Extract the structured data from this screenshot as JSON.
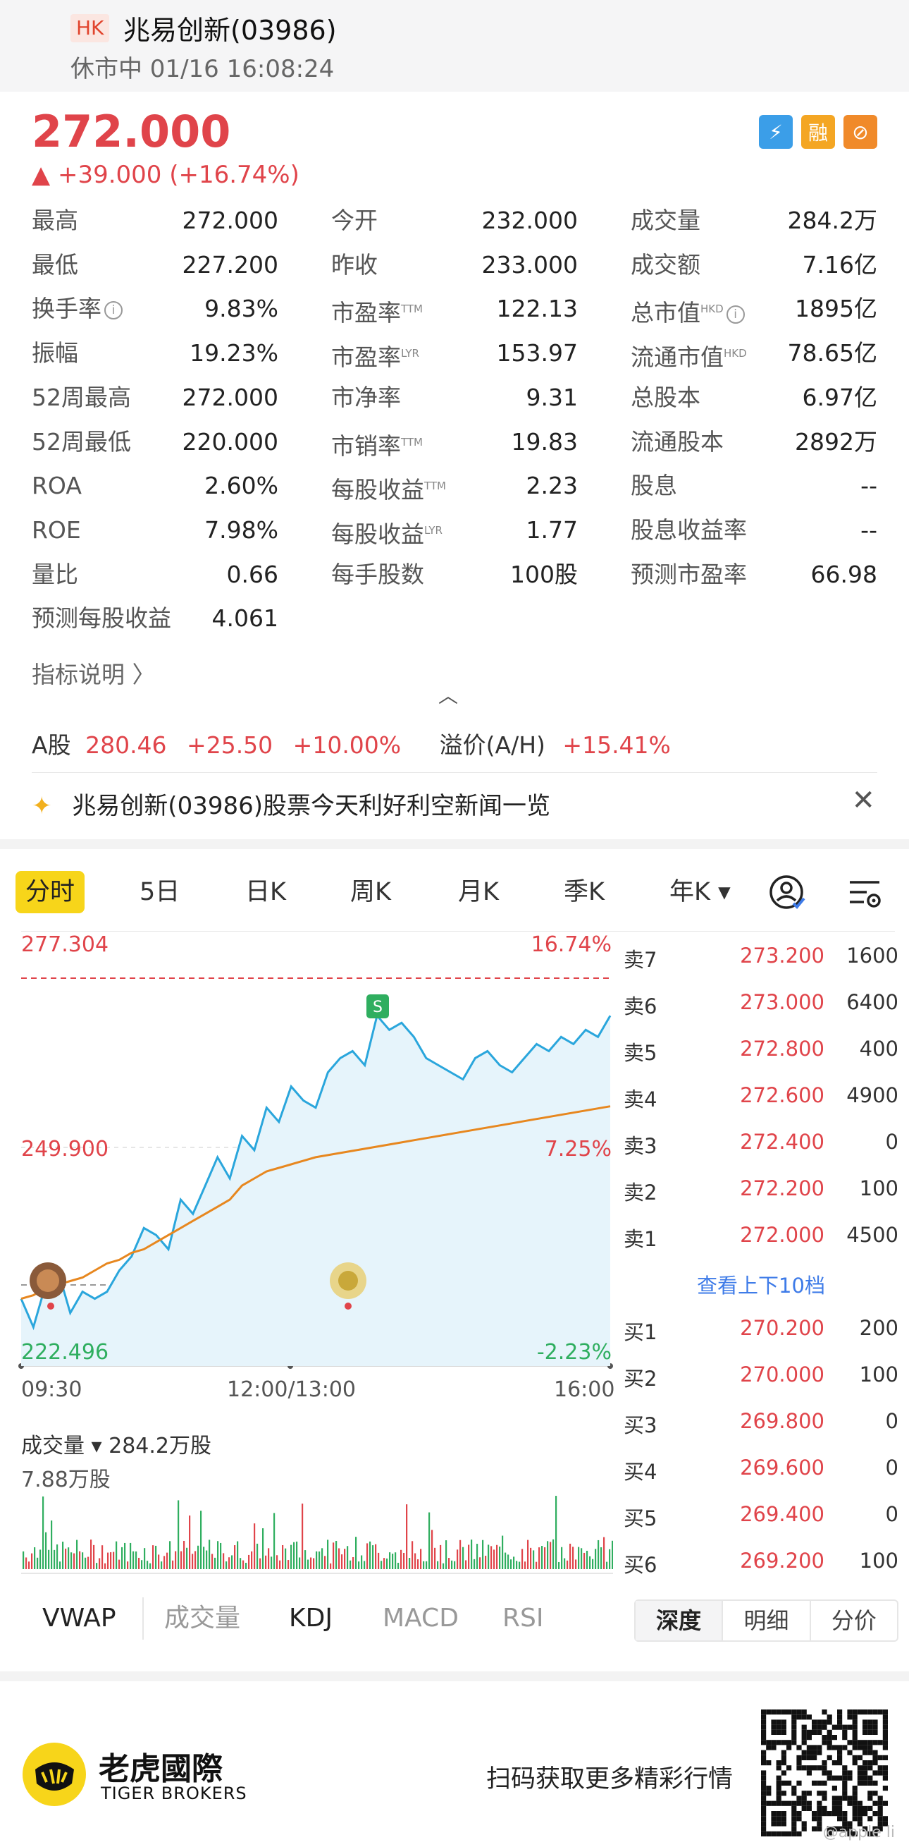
{
  "header": {
    "market_badge": "HK",
    "title": "兆易创新(03986)",
    "status": "休市中 01/16 16:08:24"
  },
  "quote": {
    "price": "272.000",
    "change": "▲ +39.000 (+16.74%)",
    "tag_icons": [
      "flash-icon",
      "margin-icon",
      "no-short-icon"
    ],
    "tag_icon_texts": [
      "⚡",
      "融",
      "⊘"
    ]
  },
  "stats": [
    [
      {
        "label": "最高",
        "sup": "",
        "value": "272.000"
      },
      {
        "label": "今开",
        "sup": "",
        "value": "232.000"
      },
      {
        "label": "成交量",
        "sup": "",
        "value": "284.2万"
      }
    ],
    [
      {
        "label": "最低",
        "sup": "",
        "value": "227.200"
      },
      {
        "label": "昨收",
        "sup": "",
        "value": "233.000"
      },
      {
        "label": "成交额",
        "sup": "",
        "value": "7.16亿"
      }
    ],
    [
      {
        "label": "换手率",
        "sup": "",
        "info": true,
        "value": "9.83%"
      },
      {
        "label": "市盈率",
        "sup": "TTM",
        "value": "122.13"
      },
      {
        "label": "总市值",
        "sup": "HKD",
        "info": true,
        "value": "1895亿"
      }
    ],
    [
      {
        "label": "振幅",
        "sup": "",
        "value": "19.23%"
      },
      {
        "label": "市盈率",
        "sup": "LYR",
        "value": "153.97"
      },
      {
        "label": "流通市值",
        "sup": "HKD",
        "value": "78.65亿"
      }
    ],
    [
      {
        "label": "52周最高",
        "sup": "",
        "value": "272.000"
      },
      {
        "label": "市净率",
        "sup": "",
        "value": "9.31"
      },
      {
        "label": "总股本",
        "sup": "",
        "value": "6.97亿"
      }
    ],
    [
      {
        "label": "52周最低",
        "sup": "",
        "value": "220.000"
      },
      {
        "label": "市销率",
        "sup": "TTM",
        "value": "19.83"
      },
      {
        "label": "流通股本",
        "sup": "",
        "value": "2892万"
      }
    ],
    [
      {
        "label": "ROA",
        "sup": "",
        "value": "2.60%"
      },
      {
        "label": "每股收益",
        "sup": "TTM",
        "value": "2.23"
      },
      {
        "label": "股息",
        "sup": "",
        "value": "--"
      }
    ],
    [
      {
        "label": "ROE",
        "sup": "",
        "value": "7.98%"
      },
      {
        "label": "每股收益",
        "sup": "LYR",
        "value": "1.77"
      },
      {
        "label": "股息收益率",
        "sup": "",
        "value": "--"
      }
    ],
    [
      {
        "label": "量比",
        "sup": "",
        "value": "0.66"
      },
      {
        "label": "每手股数",
        "sup": "",
        "value": "100股"
      },
      {
        "label": "预测市盈率",
        "sup": "",
        "value": "66.98"
      }
    ],
    [
      {
        "label": "预测每股收益",
        "sup": "",
        "value": "4.061"
      }
    ]
  ],
  "indicator_link": "指标说明 〉",
  "collapse_glyph": "︿",
  "a_share": {
    "label": "A股",
    "price": "280.46",
    "change": "+25.50",
    "pct": "+10.00%",
    "premium_label": "溢价(A/H)",
    "premium": "+15.41%"
  },
  "news": {
    "icon": "✦",
    "text": "兆易创新(03986)股票今天利好利空新闻一览",
    "close": "✕"
  },
  "chart_tabs": [
    "分时",
    "5日",
    "日K",
    "周K",
    "月K",
    "季K",
    "年K ▾"
  ],
  "chart_data": {
    "type": "line",
    "ylim": [
      222.496,
      277.304
    ],
    "y_labels_left": [
      "277.304",
      "249.900",
      "222.496"
    ],
    "y_labels_right": [
      "16.74%",
      "7.25%",
      "-2.23%"
    ],
    "x_ticks": [
      "09:30",
      "12:00/13:00",
      "16:00"
    ],
    "prev_close": 233.0,
    "series": [
      {
        "values": [
          232,
          228,
          234,
          236,
          230,
          233,
          232,
          233,
          236,
          238,
          242,
          241,
          239,
          246,
          244,
          248,
          252,
          249,
          255,
          253,
          259,
          257,
          262,
          260,
          259,
          264,
          266,
          267,
          265,
          272,
          270,
          271,
          269,
          266,
          265,
          264,
          263,
          266,
          267,
          265,
          264,
          266,
          268,
          267,
          269,
          268,
          270,
          269,
          272
        ]
      },
      {
        "values": [
          232,
          232.5,
          233.5,
          234,
          234.5,
          235,
          236,
          237,
          237.5,
          238.5,
          239,
          240,
          241,
          242,
          243,
          244,
          245,
          246,
          248,
          249,
          250,
          250.5,
          251,
          251.5,
          252,
          252.3,
          252.6,
          252.9,
          253.2,
          253.5,
          253.8,
          254.1,
          254.4,
          254.7,
          255,
          255.3,
          255.6,
          255.9,
          256.2,
          256.5,
          256.8,
          257.1,
          257.4,
          257.7,
          258,
          258.3,
          258.6,
          258.9,
          259.2
        ]
      }
    ]
  },
  "orderbook": {
    "asks": [
      {
        "side": "卖7",
        "price": "273.200",
        "qty": "1600"
      },
      {
        "side": "卖6",
        "price": "273.000",
        "qty": "6400"
      },
      {
        "side": "卖5",
        "price": "272.800",
        "qty": "400"
      },
      {
        "side": "卖4",
        "price": "272.600",
        "qty": "4900"
      },
      {
        "side": "卖3",
        "price": "272.400",
        "qty": "0"
      },
      {
        "side": "卖2",
        "price": "272.200",
        "qty": "100"
      },
      {
        "side": "卖1",
        "price": "272.000",
        "qty": "4500"
      }
    ],
    "more": "查看上下10档",
    "bids": [
      {
        "side": "买1",
        "price": "270.200",
        "qty": "200"
      },
      {
        "side": "买2",
        "price": "270.000",
        "qty": "100"
      },
      {
        "side": "买3",
        "price": "269.800",
        "qty": "0"
      },
      {
        "side": "买4",
        "price": "269.600",
        "qty": "0"
      },
      {
        "side": "买5",
        "price": "269.400",
        "qty": "0"
      },
      {
        "side": "买6",
        "price": "269.200",
        "qty": "100"
      }
    ]
  },
  "volume": {
    "title": "成交量 ▾ 284.2万股",
    "max": "7.88万股"
  },
  "indicator_tabs": [
    "VWAP",
    "成交量",
    "KDJ",
    "MACD",
    "RSI"
  ],
  "detail_tabs": [
    "深度",
    "明细",
    "分价"
  ],
  "footer": {
    "brand": "老虎國際",
    "brand_en": "TIGER BROKERS",
    "scan_text": "扫码获取更多精彩行情",
    "watermark": "@apple li"
  },
  "colors": {
    "up": "#e0444a",
    "down": "#2fae5f",
    "accent": "#f7d51a",
    "line": "#2aa6dc",
    "avg": "#e7871f",
    "link": "#3e7be8"
  }
}
